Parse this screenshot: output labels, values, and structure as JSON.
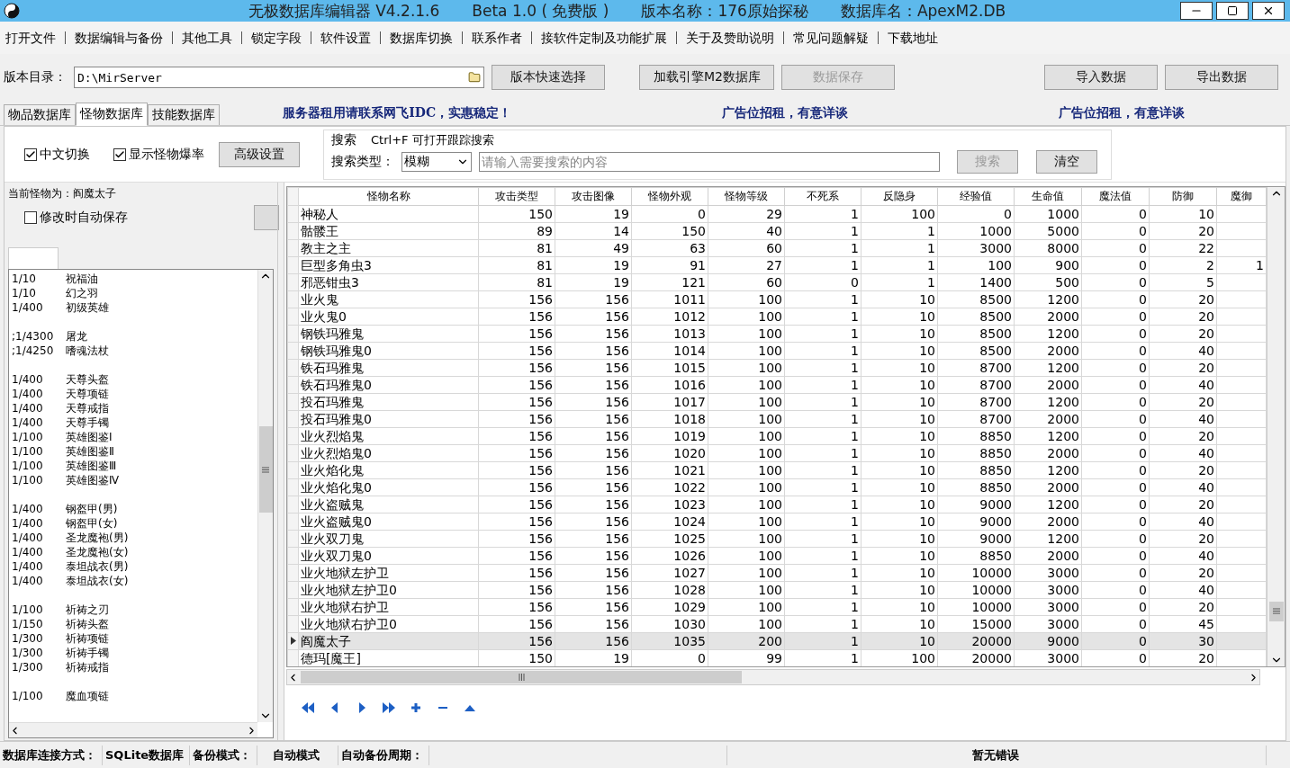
{
  "window": {
    "title_parts": [
      "无极数据库编辑器 V4.2.1.6",
      "Beta 1.0 ( 免费版 )",
      "版本名称：176原始探秘",
      "数据库名：ApexM2.DB"
    ]
  },
  "menu": [
    "打开文件",
    "数据编辑与备份",
    "其他工具",
    "锁定字段",
    "软件设置",
    "数据库切换",
    "联系作者",
    "接软件定制及功能扩展",
    "关于及赞助说明",
    "常见问题解疑",
    "下载地址"
  ],
  "directory": {
    "label": "版本目录：",
    "value": "D:\\MirServer"
  },
  "toolbar_buttons": [
    {
      "label": "版本快速选择",
      "disabled": false
    },
    {
      "label": "加载引擎M2数据库",
      "disabled": false
    },
    {
      "label": "数据保存",
      "disabled": true
    },
    {
      "label": "导入数据",
      "disabled": false
    },
    {
      "label": "导出数据",
      "disabled": false
    }
  ],
  "tabs": [
    {
      "label": "物品数据库",
      "selected": false
    },
    {
      "label": "怪物数据库",
      "selected": true
    },
    {
      "label": "技能数据库",
      "selected": false
    }
  ],
  "ads": [
    "服务器租用请联系网飞IDC，实惠稳定！",
    "广告位招租，有意详谈",
    "广告位招租，有意详谈"
  ],
  "options": [
    {
      "label": "中文切换",
      "checked": true
    },
    {
      "label": "显示怪物爆率",
      "checked": true
    }
  ],
  "advanced_button": "高级设置",
  "search": {
    "title": "搜索",
    "hint": "Ctrl+F 可打开跟踪搜索",
    "type_label": "搜索类型：",
    "type_value": "模糊",
    "placeholder": "请输入需要搜索的内容",
    "buttons": [
      {
        "label": "搜索",
        "disabled": true
      },
      {
        "label": "清空",
        "disabled": false
      }
    ]
  },
  "left_panel": {
    "current": "当前怪物为：阎魔太子",
    "autosave": {
      "label": "修改时自动保存",
      "checked": false
    },
    "drop_groups": [
      [
        {
          "rate": "1/10",
          "item": "祝福油"
        },
        {
          "rate": "1/10",
          "item": "幻之羽"
        },
        {
          "rate": "1/400",
          "item": "初级英雄"
        }
      ],
      [
        {
          "rate": ";1/4300",
          "item": "屠龙"
        },
        {
          "rate": ";1/4250",
          "item": "嗜魂法杖"
        }
      ],
      [
        {
          "rate": "1/400",
          "item": "天尊头盔"
        },
        {
          "rate": "1/400",
          "item": "天尊项链"
        },
        {
          "rate": "1/400",
          "item": "天尊戒指"
        },
        {
          "rate": "1/400",
          "item": "天尊手镯"
        },
        {
          "rate": "1/100",
          "item": "英雄图鉴Ⅰ"
        },
        {
          "rate": "1/100",
          "item": "英雄图鉴Ⅱ"
        },
        {
          "rate": "1/100",
          "item": "英雄图鉴Ⅲ"
        },
        {
          "rate": "1/100",
          "item": "英雄图鉴Ⅳ"
        }
      ],
      [
        {
          "rate": "1/400",
          "item": "钢盔甲(男)"
        },
        {
          "rate": "1/400",
          "item": "钢盔甲(女)"
        },
        {
          "rate": "1/400",
          "item": "圣龙魔袍(男)"
        },
        {
          "rate": "1/400",
          "item": "圣龙魔袍(女)"
        },
        {
          "rate": "1/400",
          "item": "泰坦战衣(男)"
        },
        {
          "rate": "1/400",
          "item": "泰坦战衣(女)"
        }
      ],
      [
        {
          "rate": "1/100",
          "item": "祈祷之刃"
        },
        {
          "rate": "1/150",
          "item": "祈祷头盔"
        },
        {
          "rate": "1/300",
          "item": "祈祷项链"
        },
        {
          "rate": "1/300",
          "item": "祈祷手镯"
        },
        {
          "rate": "1/300",
          "item": "祈祷戒指"
        }
      ],
      [
        {
          "rate": "1/100",
          "item": "魔血项链"
        }
      ]
    ]
  },
  "table": {
    "columns": [
      "怪物名称",
      "攻击类型",
      "攻击图像",
      "怪物外观",
      "怪物等级",
      "不死系",
      "反隐身",
      "经验值",
      "生命值",
      "魔法值",
      "防御",
      "魔御"
    ],
    "rows": [
      {
        "cells": [
          "神秘人",
          "150",
          "19",
          "0",
          "29",
          "1",
          "100",
          "0",
          "1000",
          "0",
          "10",
          ""
        ],
        "selected": false
      },
      {
        "cells": [
          "骷髅王",
          "89",
          "14",
          "150",
          "40",
          "1",
          "1",
          "1000",
          "5000",
          "0",
          "20",
          ""
        ],
        "selected": false
      },
      {
        "cells": [
          "教主之主",
          "81",
          "49",
          "63",
          "60",
          "1",
          "1",
          "3000",
          "8000",
          "0",
          "22",
          ""
        ],
        "selected": false
      },
      {
        "cells": [
          "巨型多角虫3",
          "81",
          "19",
          "91",
          "27",
          "1",
          "1",
          "100",
          "900",
          "0",
          "2",
          "1"
        ],
        "selected": false
      },
      {
        "cells": [
          "邪恶钳虫3",
          "81",
          "19",
          "121",
          "60",
          "0",
          "1",
          "1400",
          "500",
          "0",
          "5",
          ""
        ],
        "selected": false
      },
      {
        "cells": [
          "业火鬼",
          "156",
          "156",
          "1011",
          "100",
          "1",
          "10",
          "8500",
          "1200",
          "0",
          "20",
          ""
        ],
        "selected": false
      },
      {
        "cells": [
          "业火鬼0",
          "156",
          "156",
          "1012",
          "100",
          "1",
          "10",
          "8500",
          "2000",
          "0",
          "20",
          ""
        ],
        "selected": false
      },
      {
        "cells": [
          "钢铁玛雅鬼",
          "156",
          "156",
          "1013",
          "100",
          "1",
          "10",
          "8500",
          "1200",
          "0",
          "20",
          ""
        ],
        "selected": false
      },
      {
        "cells": [
          "钢铁玛雅鬼0",
          "156",
          "156",
          "1014",
          "100",
          "1",
          "10",
          "8500",
          "2000",
          "0",
          "40",
          ""
        ],
        "selected": false
      },
      {
        "cells": [
          "铁石玛雅鬼",
          "156",
          "156",
          "1015",
          "100",
          "1",
          "10",
          "8700",
          "1200",
          "0",
          "20",
          ""
        ],
        "selected": false
      },
      {
        "cells": [
          "铁石玛雅鬼0",
          "156",
          "156",
          "1016",
          "100",
          "1",
          "10",
          "8700",
          "2000",
          "0",
          "40",
          ""
        ],
        "selected": false
      },
      {
        "cells": [
          "投石玛雅鬼",
          "156",
          "156",
          "1017",
          "100",
          "1",
          "10",
          "8700",
          "1200",
          "0",
          "20",
          ""
        ],
        "selected": false
      },
      {
        "cells": [
          "投石玛雅鬼0",
          "156",
          "156",
          "1018",
          "100",
          "1",
          "10",
          "8700",
          "2000",
          "0",
          "40",
          ""
        ],
        "selected": false
      },
      {
        "cells": [
          "业火烈焰鬼",
          "156",
          "156",
          "1019",
          "100",
          "1",
          "10",
          "8850",
          "1200",
          "0",
          "20",
          ""
        ],
        "selected": false
      },
      {
        "cells": [
          "业火烈焰鬼0",
          "156",
          "156",
          "1020",
          "100",
          "1",
          "10",
          "8850",
          "2000",
          "0",
          "40",
          ""
        ],
        "selected": false
      },
      {
        "cells": [
          "业火焰化鬼",
          "156",
          "156",
          "1021",
          "100",
          "1",
          "10",
          "8850",
          "1200",
          "0",
          "20",
          ""
        ],
        "selected": false
      },
      {
        "cells": [
          "业火焰化鬼0",
          "156",
          "156",
          "1022",
          "100",
          "1",
          "10",
          "8850",
          "2000",
          "0",
          "40",
          ""
        ],
        "selected": false
      },
      {
        "cells": [
          "业火盗贼鬼",
          "156",
          "156",
          "1023",
          "100",
          "1",
          "10",
          "9000",
          "1200",
          "0",
          "20",
          ""
        ],
        "selected": false
      },
      {
        "cells": [
          "业火盗贼鬼0",
          "156",
          "156",
          "1024",
          "100",
          "1",
          "10",
          "9000",
          "2000",
          "0",
          "40",
          ""
        ],
        "selected": false
      },
      {
        "cells": [
          "业火双刀鬼",
          "156",
          "156",
          "1025",
          "100",
          "1",
          "10",
          "9000",
          "1200",
          "0",
          "20",
          ""
        ],
        "selected": false
      },
      {
        "cells": [
          "业火双刀鬼0",
          "156",
          "156",
          "1026",
          "100",
          "1",
          "10",
          "8850",
          "2000",
          "0",
          "40",
          ""
        ],
        "selected": false
      },
      {
        "cells": [
          "业火地狱左护卫",
          "156",
          "156",
          "1027",
          "100",
          "1",
          "10",
          "10000",
          "3000",
          "0",
          "20",
          ""
        ],
        "selected": false
      },
      {
        "cells": [
          "业火地狱左护卫0",
          "156",
          "156",
          "1028",
          "100",
          "1",
          "10",
          "10000",
          "3000",
          "0",
          "40",
          ""
        ],
        "selected": false
      },
      {
        "cells": [
          "业火地狱右护卫",
          "156",
          "156",
          "1029",
          "100",
          "1",
          "10",
          "10000",
          "3000",
          "0",
          "20",
          ""
        ],
        "selected": false
      },
      {
        "cells": [
          "业火地狱右护卫0",
          "156",
          "156",
          "1030",
          "100",
          "1",
          "10",
          "15000",
          "3000",
          "0",
          "45",
          ""
        ],
        "selected": false
      },
      {
        "cells": [
          "阎魔太子",
          "156",
          "156",
          "1035",
          "200",
          "1",
          "10",
          "20000",
          "9000",
          "0",
          "30",
          ""
        ],
        "selected": true
      },
      {
        "cells": [
          "德玛[魔王]",
          "150",
          "19",
          "0",
          "99",
          "1",
          "100",
          "20000",
          "3000",
          "0",
          "20",
          ""
        ],
        "selected": false
      }
    ]
  },
  "status_bar": [
    {
      "label": "数据库连接方式：",
      "value": "SQLite数据库"
    },
    {
      "label": "备份模式：",
      "value": "自动模式"
    },
    {
      "label": "自动备份周期："
    },
    {
      "value": "暂无错误"
    }
  ]
}
